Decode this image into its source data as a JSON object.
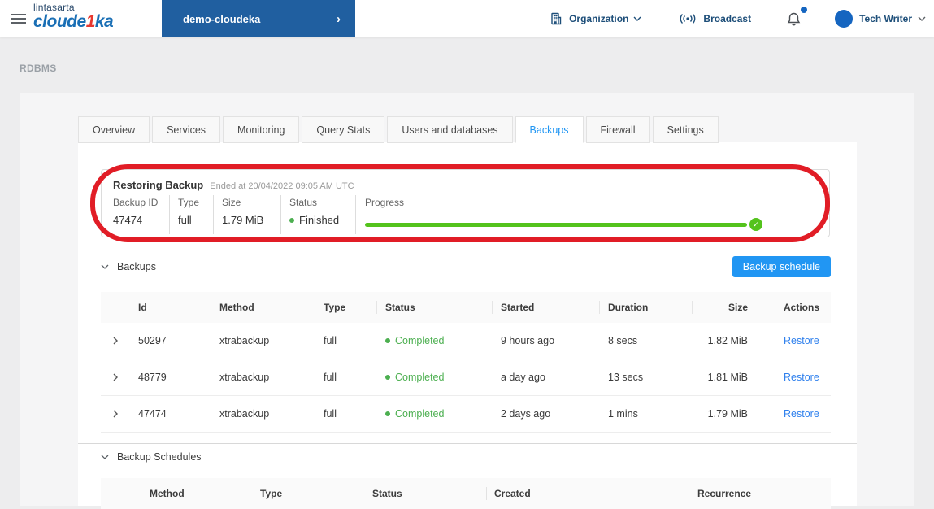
{
  "topbar": {
    "brand": {
      "line1": "lintasarta",
      "word_start": "cloude",
      "word_accent": "1",
      "word_end": "ka"
    },
    "project_button": {
      "label": "demo-cloudeka",
      "chevron": "›"
    },
    "organization_label": "Organization",
    "broadcast_label": "Broadcast",
    "user_label": "Tech Writer"
  },
  "breadcrumb": "RDBMS",
  "tabs": [
    {
      "label": "Overview",
      "active": false
    },
    {
      "label": "Services",
      "active": false
    },
    {
      "label": "Monitoring",
      "active": false
    },
    {
      "label": "Query Stats",
      "active": false
    },
    {
      "label": "Users and databases",
      "active": false
    },
    {
      "label": "Backups",
      "active": true
    },
    {
      "label": "Firewall",
      "active": false
    },
    {
      "label": "Settings",
      "active": false
    }
  ],
  "restore_panel": {
    "title": "Restoring Backup",
    "subtitle": "Ended at 20/04/2022 09:05 AM UTC",
    "fields": {
      "backup_id": {
        "label": "Backup ID",
        "value": "47474"
      },
      "type": {
        "label": "Type",
        "value": "full"
      },
      "size": {
        "label": "Size",
        "value": "1.79 MiB"
      },
      "status": {
        "label": "Status",
        "value": "Finished"
      }
    },
    "progress_label": "Progress",
    "progress_percent": 100
  },
  "backups": {
    "section_title": "Backups",
    "schedule_button": "Backup schedule",
    "table": {
      "headers": [
        "Id",
        "Method",
        "Type",
        "Status",
        "Started",
        "Duration",
        "Size",
        "Actions"
      ],
      "rows": [
        {
          "id": "50297",
          "method": "xtrabackup",
          "type": "full",
          "status": "Completed",
          "started": "9 hours ago",
          "duration": "8 secs",
          "size": "1.82 MiB",
          "action": "Restore"
        },
        {
          "id": "48779",
          "method": "xtrabackup",
          "type": "full",
          "status": "Completed",
          "started": "a day ago",
          "duration": "13 secs",
          "size": "1.81 MiB",
          "action": "Restore"
        },
        {
          "id": "47474",
          "method": "xtrabackup",
          "type": "full",
          "status": "Completed",
          "started": "2 days ago",
          "duration": "1 mins",
          "size": "1.79 MiB",
          "action": "Restore"
        }
      ]
    }
  },
  "schedules": {
    "section_title": "Backup Schedules",
    "headers": [
      "Method",
      "Type",
      "Status",
      "Created",
      "Recurrence"
    ]
  },
  "icons": {
    "project_chevron": "›",
    "check": "✓",
    "section_chevron": "∨"
  },
  "colors": {
    "accent_blue": "#2196f3",
    "project_button_blue": "#205fa0",
    "brand_blue": "#1a6fb5",
    "brand_red": "#e8382f",
    "header_navy": "#1d4e79",
    "success_green": "#4caf50",
    "progress_green": "#54c31c",
    "link_blue": "#2f80ed",
    "annotation_red": "#e11d26"
  }
}
